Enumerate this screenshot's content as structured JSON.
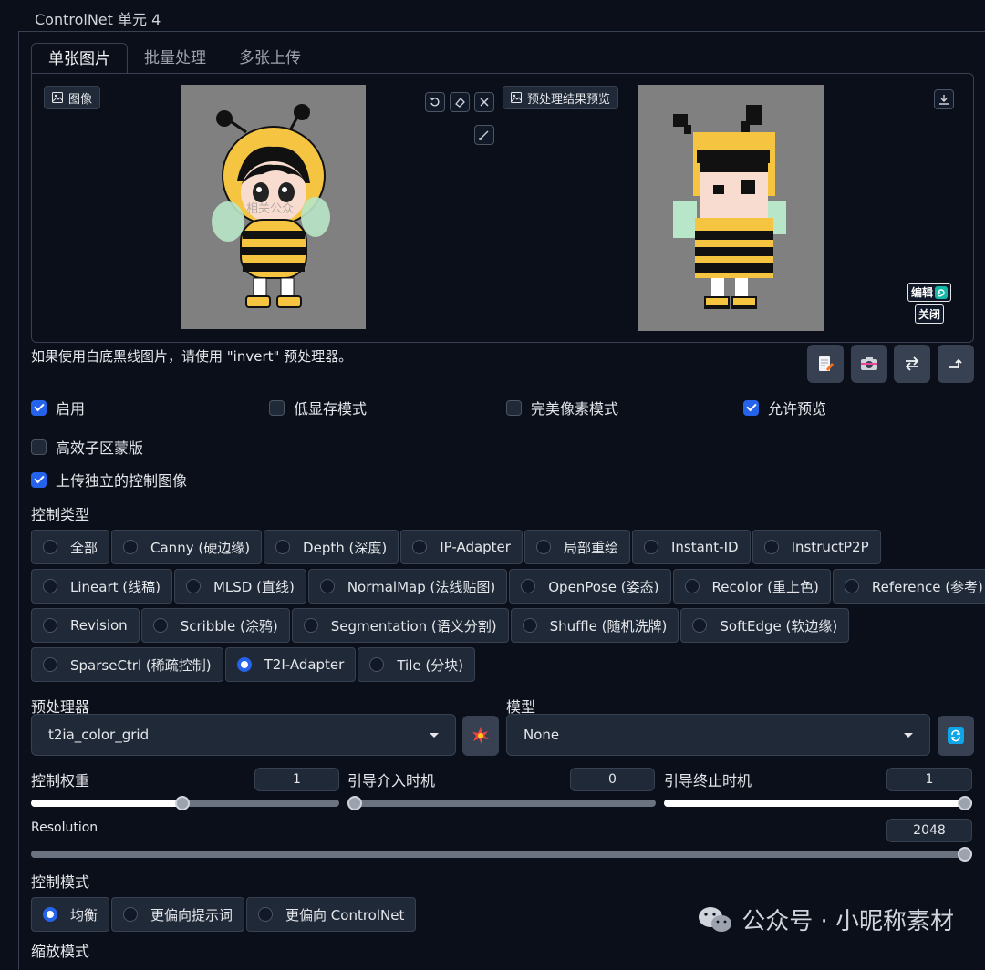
{
  "header": {
    "title": "ControlNet 单元 4"
  },
  "tabs": [
    {
      "label": "单张图片"
    },
    {
      "label": "批量处理"
    },
    {
      "label": "多张上传"
    }
  ],
  "image_panel": {
    "input_label": "图像",
    "preview_label": "预处理结果预览",
    "edit_label": "编辑",
    "close_label": "关闭",
    "input_watermark": "相关公众"
  },
  "hint": "如果使用白底黑线图片，请使用 \"invert\" 预处理器。",
  "checkboxes": {
    "enable": {
      "label": "启用",
      "checked": true
    },
    "low_vram": {
      "label": "低显存模式",
      "checked": false
    },
    "pixel_perfect": {
      "label": "完美像素模式",
      "checked": false
    },
    "allow_preview": {
      "label": "允许预览",
      "checked": true
    },
    "efficient_mask": {
      "label": "高效子区蒙版",
      "checked": false
    },
    "independent_image": {
      "label": "上传独立的控制图像",
      "checked": true
    }
  },
  "control_type": {
    "title": "控制类型",
    "options": [
      "全部",
      "Canny (硬边缘)",
      "Depth (深度)",
      "IP-Adapter",
      "局部重绘",
      "Instant-ID",
      "InstructP2P",
      "Lineart (线稿)",
      "MLSD (直线)",
      "NormalMap (法线贴图)",
      "OpenPose (姿态)",
      "Recolor (重上色)",
      "Reference (参考)",
      "Revision",
      "Scribble (涂鸦)",
      "Segmentation (语义分割)",
      "Shuffle (随机洗牌)",
      "SoftEdge (软边缘)",
      "SparseCtrl (稀疏控制)",
      "T2I-Adapter",
      "Tile (分块)"
    ],
    "selected": "T2I-Adapter"
  },
  "preprocessor": {
    "label": "预处理器",
    "value": "t2ia_color_grid"
  },
  "model": {
    "label": "模型",
    "value": "None"
  },
  "sliders": {
    "weight": {
      "label": "控制权重",
      "value": "1",
      "fraction": 0.49
    },
    "start": {
      "label": "引导介入时机",
      "value": "0",
      "fraction": 0.0
    },
    "end": {
      "label": "引导终止时机",
      "value": "1",
      "fraction": 1.0
    },
    "resolution": {
      "label": "Resolution",
      "value": "2048",
      "fraction": 1.0
    }
  },
  "control_mode": {
    "title": "控制模式",
    "options": [
      "均衡",
      "更偏向提示词",
      "更偏向 ControlNet"
    ],
    "selected": "均衡"
  },
  "resize_mode": {
    "title": "缩放模式"
  },
  "watermark": {
    "text": "公众号 · 小昵称素材"
  },
  "colors": {
    "accent": "#2563eb",
    "background": "#0b0f19",
    "panel": "#1f2937"
  }
}
